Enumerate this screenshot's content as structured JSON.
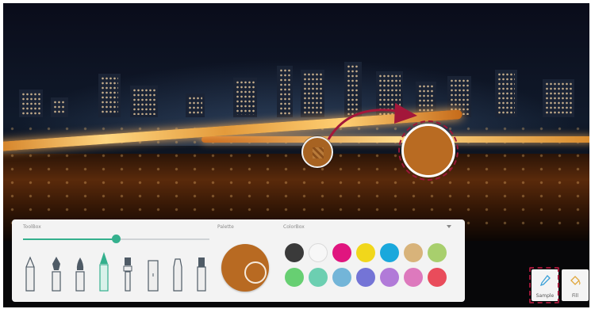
{
  "toolbox": {
    "label": "ToolBox",
    "slider_value": 0.5,
    "tools": [
      "pencil-icon",
      "fountain-pen-icon",
      "brush-icon",
      "highlighter-icon",
      "marker-icon",
      "eraser-icon",
      "chalk-icon",
      "crayon-icon"
    ],
    "selected_tool_index": 3
  },
  "palette": {
    "label": "Palette",
    "current_color": "#b86a22"
  },
  "colorbox": {
    "label": "ColorBox",
    "colors": [
      "#3a3a3a",
      "#f7f7f7",
      "#e0157f",
      "#f1d71b",
      "#1aa8dc",
      "#d8b37a",
      "#a8cf6d",
      "#67cf72",
      "#6ccfb1",
      "#73b5d8",
      "#7474d6",
      "#b17ad8",
      "#dd79bd",
      "#e94c5b"
    ]
  },
  "tools_right": {
    "sample_label": "Sample",
    "fill_label": "Fill"
  },
  "sampled_color": "#b96b22"
}
